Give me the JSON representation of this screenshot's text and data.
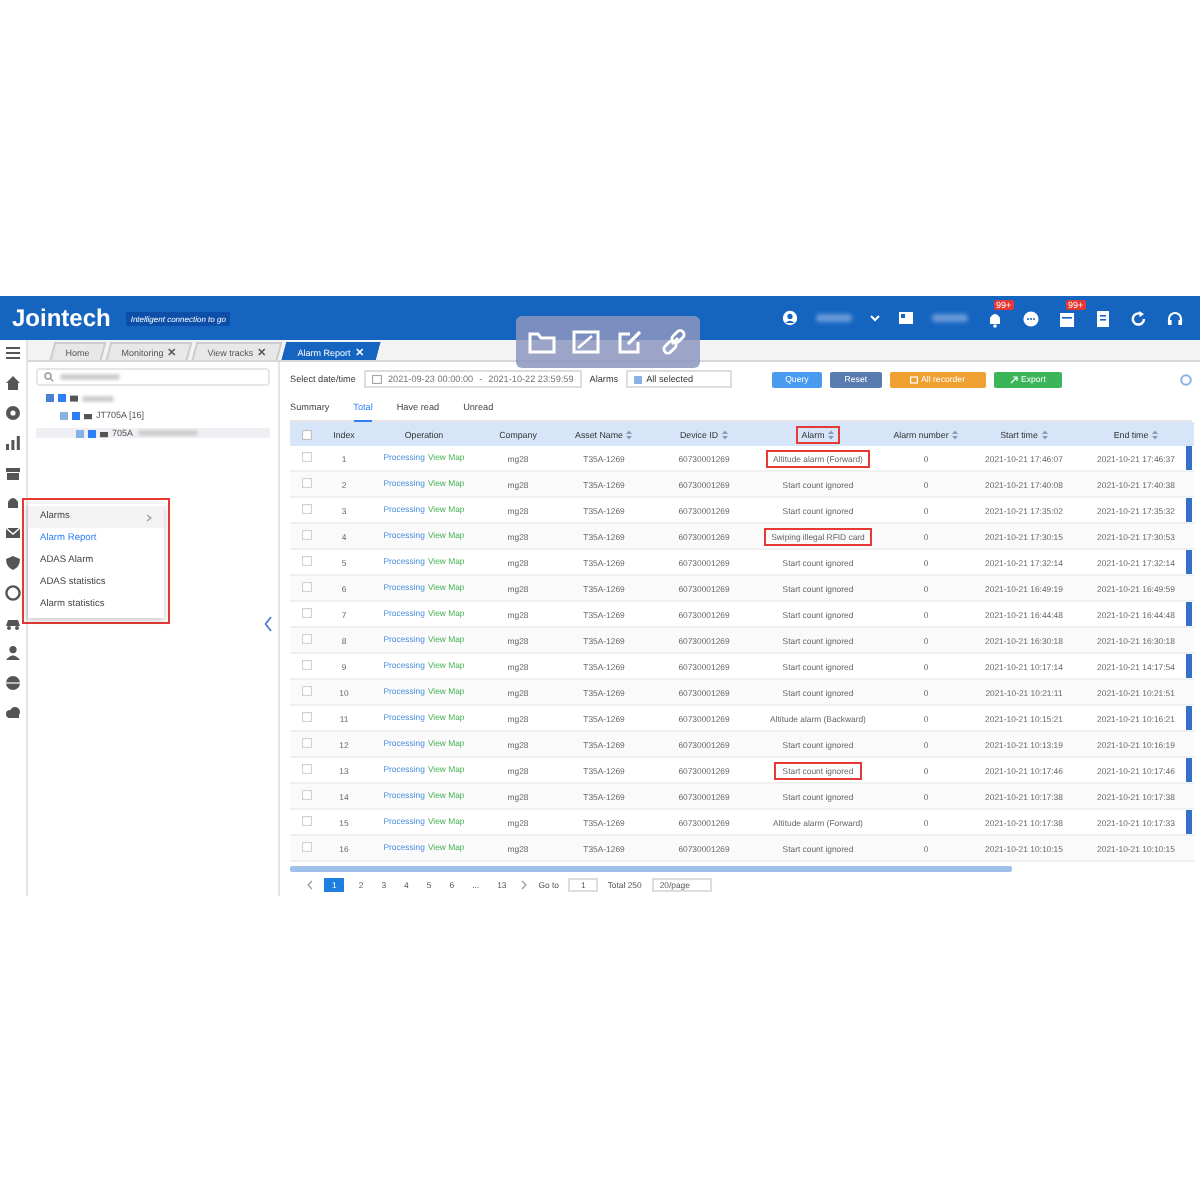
{
  "header": {
    "logo": "Jointech",
    "tagline": "Intelligent connection to go",
    "badges": [
      "99+",
      "99+"
    ]
  },
  "tabs": [
    {
      "label": "Home",
      "closable": false,
      "selected": false
    },
    {
      "label": "Monitoring",
      "closable": true,
      "selected": false
    },
    {
      "label": "View tracks",
      "closable": true,
      "selected": false
    },
    {
      "label": "Alarm Report",
      "closable": true,
      "selected": true
    }
  ],
  "sidebar": {
    "tree": [
      {
        "label": "JT705A [16]",
        "checked": true,
        "children": [
          {
            "label": "705A",
            "checked": true
          }
        ]
      }
    ],
    "menu": {
      "title": "Alarms",
      "highlighted": true,
      "items": [
        {
          "label": "Alarm Report",
          "selected": true
        },
        {
          "label": "ADAS Alarm",
          "selected": false
        },
        {
          "label": "ADAS statistics",
          "selected": false
        },
        {
          "label": "Alarm statistics",
          "selected": false
        }
      ]
    }
  },
  "filters": {
    "date_label": "Select date/time",
    "date_start": "2021-09-23 00:00:00",
    "date_separator": "-",
    "date_end": "2021-10-22 23:59:59",
    "alarm_label": "Alarms",
    "alarm_value": "All selected",
    "buttons": [
      {
        "label": "Query",
        "kind": "query"
      },
      {
        "label": "Reset",
        "kind": "reset"
      },
      {
        "label": "All recorder",
        "kind": "records"
      },
      {
        "label": "Export",
        "kind": "export"
      }
    ]
  },
  "subtabs": [
    {
      "label": "Summary",
      "selected": false
    },
    {
      "label": "Total",
      "selected": true
    },
    {
      "label": "Have read",
      "selected": false
    },
    {
      "label": "Unread",
      "selected": false
    }
  ],
  "table": {
    "columns": [
      {
        "label": "Index",
        "sortable": false,
        "highlighted": false
      },
      {
        "label": "Operation",
        "sortable": false,
        "highlighted": false
      },
      {
        "label": "Company",
        "sortable": false,
        "highlighted": false
      },
      {
        "label": "Asset Name",
        "sortable": true,
        "highlighted": false
      },
      {
        "label": "Device ID",
        "sortable": true,
        "highlighted": false
      },
      {
        "label": "Alarm",
        "sortable": true,
        "highlighted": true
      },
      {
        "label": "Alarm number",
        "sortable": true,
        "highlighted": false
      },
      {
        "label": "Start time",
        "sortable": true,
        "highlighted": false
      },
      {
        "label": "End time",
        "sortable": true,
        "highlighted": false
      }
    ],
    "rows": [
      {
        "index": "1",
        "actions": [
          {
            "label": "Processing",
            "kind": "process"
          },
          {
            "label": "View Map",
            "kind": "map"
          }
        ],
        "company": "mg28",
        "asset": "T35A-1269",
        "device": "60730001269",
        "alarm": "Altitude alarm (Forward)",
        "highlighted": true,
        "number": "0",
        "start": "2021-10-21 17:46:07",
        "end": "2021-10-21 17:46:37"
      },
      {
        "index": "2",
        "actions": [
          {
            "label": "Processing",
            "kind": "process"
          },
          {
            "label": "View Map",
            "kind": "map"
          }
        ],
        "company": "mg28",
        "asset": "T35A-1269",
        "device": "60730001269",
        "alarm": "Start count ignored",
        "highlighted": false,
        "number": "0",
        "start": "2021-10-21 17:40:08",
        "end": "2021-10-21 17:40:38"
      },
      {
        "index": "3",
        "actions": [
          {
            "label": "Processing",
            "kind": "process"
          },
          {
            "label": "View Map",
            "kind": "map"
          }
        ],
        "company": "mg28",
        "asset": "T35A-1269",
        "device": "60730001269",
        "alarm": "Start count ignored",
        "highlighted": false,
        "number": "0",
        "start": "2021-10-21 17:35:02",
        "end": "2021-10-21 17:35:32"
      },
      {
        "index": "4",
        "actions": [
          {
            "label": "Processing",
            "kind": "process"
          },
          {
            "label": "View Map",
            "kind": "map"
          }
        ],
        "company": "mg28",
        "asset": "T35A-1269",
        "device": "60730001269",
        "alarm": "Swiping illegal RFID card",
        "highlighted": true,
        "number": "0",
        "start": "2021-10-21 17:30:15",
        "end": "2021-10-21 17:30:53"
      },
      {
        "index": "5",
        "actions": [
          {
            "label": "Processing",
            "kind": "process"
          },
          {
            "label": "View Map",
            "kind": "map"
          }
        ],
        "company": "mg28",
        "asset": "T35A-1269",
        "device": "60730001269",
        "alarm": "Start count ignored",
        "highlighted": false,
        "number": "0",
        "start": "2021-10-21 17:32:14",
        "end": "2021-10-21 17:32:14"
      },
      {
        "index": "6",
        "actions": [
          {
            "label": "Processing",
            "kind": "process"
          },
          {
            "label": "View Map",
            "kind": "map"
          }
        ],
        "company": "mg28",
        "asset": "T35A-1269",
        "device": "60730001269",
        "alarm": "Start count ignored",
        "highlighted": false,
        "number": "0",
        "start": "2021-10-21 16:49:19",
        "end": "2021-10-21 16:49:59"
      },
      {
        "index": "7",
        "actions": [
          {
            "label": "Processing",
            "kind": "process"
          },
          {
            "label": "View Map",
            "kind": "map"
          }
        ],
        "company": "mg28",
        "asset": "T35A-1269",
        "device": "60730001269",
        "alarm": "Start count ignored",
        "highlighted": false,
        "number": "0",
        "start": "2021-10-21 16:44:48",
        "end": "2021-10-21 16:44:48"
      },
      {
        "index": "8",
        "actions": [
          {
            "label": "Processing",
            "kind": "process"
          },
          {
            "label": "View Map",
            "kind": "map"
          }
        ],
        "company": "mg28",
        "asset": "T35A-1269",
        "device": "60730001269",
        "alarm": "Start count ignored",
        "highlighted": false,
        "number": "0",
        "start": "2021-10-21 16:30:18",
        "end": "2021-10-21 16:30:18"
      },
      {
        "index": "9",
        "actions": [
          {
            "label": "Processing",
            "kind": "process"
          },
          {
            "label": "View Map",
            "kind": "map"
          }
        ],
        "company": "mg28",
        "asset": "T35A-1269",
        "device": "60730001269",
        "alarm": "Start count ignored",
        "highlighted": false,
        "number": "0",
        "start": "2021-10-21 10:17:14",
        "end": "2021-10-21 14:17:54"
      },
      {
        "index": "10",
        "actions": [
          {
            "label": "Processing",
            "kind": "process"
          },
          {
            "label": "View Map",
            "kind": "map"
          }
        ],
        "company": "mg28",
        "asset": "T35A-1269",
        "device": "60730001269",
        "alarm": "Start count ignored",
        "highlighted": false,
        "number": "0",
        "start": "2021-10-21 10:21:11",
        "end": "2021-10-21 10:21:51"
      },
      {
        "index": "11",
        "actions": [
          {
            "label": "Processing",
            "kind": "process"
          },
          {
            "label": "View Map",
            "kind": "map"
          }
        ],
        "company": "mg28",
        "asset": "T35A-1269",
        "device": "60730001269",
        "alarm": "Altitude alarm (Backward)",
        "highlighted": false,
        "number": "0",
        "start": "2021-10-21 10:15:21",
        "end": "2021-10-21 10:16:21"
      },
      {
        "index": "12",
        "actions": [
          {
            "label": "Processing",
            "kind": "process"
          },
          {
            "label": "View Map",
            "kind": "map"
          }
        ],
        "company": "mg28",
        "asset": "T35A-1269",
        "device": "60730001269",
        "alarm": "Start count ignored",
        "highlighted": false,
        "number": "0",
        "start": "2021-10-21 10:13:19",
        "end": "2021-10-21 10:16:19"
      },
      {
        "index": "13",
        "actions": [
          {
            "label": "Processing",
            "kind": "process"
          },
          {
            "label": "View Map",
            "kind": "map"
          }
        ],
        "company": "mg28",
        "asset": "T35A-1269",
        "device": "60730001269",
        "alarm": "Start count ignored",
        "highlighted": true,
        "number": "0",
        "start": "2021-10-21 10:17:46",
        "end": "2021-10-21 10:17:46"
      },
      {
        "index": "14",
        "actions": [
          {
            "label": "Processing",
            "kind": "process"
          },
          {
            "label": "View Map",
            "kind": "map"
          }
        ],
        "company": "mg28",
        "asset": "T35A-1269",
        "device": "60730001269",
        "alarm": "Start count ignored",
        "highlighted": false,
        "number": "0",
        "start": "2021-10-21 10:17:38",
        "end": "2021-10-21 10:17:38"
      },
      {
        "index": "15",
        "actions": [
          {
            "label": "Processing",
            "kind": "process"
          },
          {
            "label": "View Map",
            "kind": "map"
          }
        ],
        "company": "mg28",
        "asset": "T35A-1269",
        "device": "60730001269",
        "alarm": "Altitude alarm (Forward)",
        "highlighted": false,
        "number": "0",
        "start": "2021-10-21 10:17:38",
        "end": "2021-10-21 10:17:33"
      },
      {
        "index": "16",
        "actions": [
          {
            "label": "Processing",
            "kind": "process"
          },
          {
            "label": "View Map",
            "kind": "map"
          }
        ],
        "company": "mg28",
        "asset": "T35A-1269",
        "device": "60730001269",
        "alarm": "Start count ignored",
        "highlighted": false,
        "number": "0",
        "start": "2021-10-21 10:10:15",
        "end": "2021-10-21 10:10:15"
      }
    ]
  },
  "pagination": {
    "pages": [
      {
        "label": "1",
        "selected": true
      },
      {
        "label": "2",
        "selected": false
      },
      {
        "label": "3",
        "selected": false
      },
      {
        "label": "4",
        "selected": false
      },
      {
        "label": "5",
        "selected": false
      },
      {
        "label": "6",
        "selected": false
      },
      {
        "label": "...",
        "selected": false
      },
      {
        "label": "13",
        "selected": false
      }
    ],
    "goto_label": "Go to",
    "goto_value": "1",
    "total": "Total 250",
    "page_size": "20/page"
  }
}
